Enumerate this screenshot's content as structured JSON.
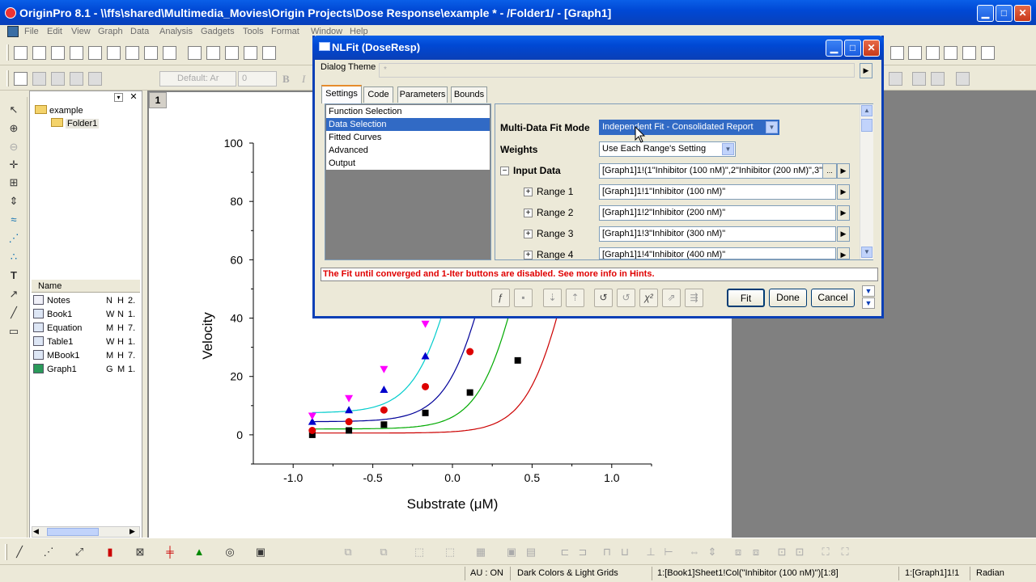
{
  "app": {
    "title": "OriginPro 8.1 - \\\\ffs\\shared\\Multimedia_Movies\\Origin Projects\\Dose Response\\example * - /Folder1/ - [Graph1]",
    "minimize": "▁",
    "maximize": "□",
    "close": "✕"
  },
  "menu": [
    "File",
    "Edit",
    "View",
    "Graph",
    "Data",
    "Analysis",
    "Gadgets",
    "Tools",
    "Format",
    "Window",
    "Help"
  ],
  "format_toolbar": {
    "font": "Default: Ar",
    "size": "0",
    "bold": "B",
    "italic": "I"
  },
  "explorer": {
    "root": "example",
    "folder": "Folder1",
    "list_header": "Name",
    "items": [
      {
        "name": "Notes",
        "c2": "N",
        "c3": "H",
        "c4": "2."
      },
      {
        "name": "Book1",
        "c2": "W",
        "c3": "N",
        "c4": "1."
      },
      {
        "name": "Equation",
        "c2": "M",
        "c3": "H",
        "c4": "7."
      },
      {
        "name": "Table1",
        "c2": "W",
        "c3": "H",
        "c4": "1."
      },
      {
        "name": "MBook1",
        "c2": "M",
        "c3": "H",
        "c4": "7."
      },
      {
        "name": "Graph1",
        "c2": "G",
        "c3": "M",
        "c4": "1."
      }
    ]
  },
  "page_number": "1",
  "chart_data": {
    "type": "scatter",
    "xlabel": "Substrate (μM)",
    "ylabel": "Velocity",
    "xlim": [
      -1.25,
      1.25
    ],
    "ylim": [
      -10,
      100
    ],
    "x_ticks": [
      "-1.0",
      "-0.5",
      "0.0",
      "0.5",
      "1.0"
    ],
    "y_ticks": [
      "0",
      "20",
      "40",
      "60",
      "80",
      "100"
    ],
    "series": [
      {
        "color": "#000000",
        "marker": "square",
        "x": [
          -0.88,
          -0.65,
          -0.43,
          -0.17,
          0.11,
          0.41
        ],
        "y": [
          0,
          1.5,
          3.5,
          7.5,
          14.5,
          25.5
        ]
      },
      {
        "color": "#dd0000",
        "marker": "circle",
        "x": [
          -0.88,
          -0.65,
          -0.43,
          -0.17,
          0.11
        ],
        "y": [
          1.5,
          4.5,
          8.5,
          16.5,
          28.5
        ]
      },
      {
        "color": "#0000cc",
        "marker": "triangle-up",
        "x": [
          -0.88,
          -0.65,
          -0.43,
          -0.17
        ],
        "y": [
          4.5,
          8.5,
          15.5,
          27
        ]
      },
      {
        "color": "#ff00ff",
        "marker": "triangle-down",
        "x": [
          -0.88,
          -0.65,
          -0.43,
          -0.17
        ],
        "y": [
          6.5,
          12.5,
          22.5,
          38
        ]
      }
    ]
  },
  "dialog": {
    "title": "NLFit (DoseResp)",
    "theme_label": "Dialog Theme",
    "theme_value": "*",
    "tabs": [
      "Settings",
      "Code",
      "Parameters",
      "Bounds"
    ],
    "nav_items": [
      "Function Selection",
      "Data Selection",
      "Fitted Curves",
      "Advanced",
      "Output"
    ],
    "multi_data_label": "Multi-Data Fit Mode",
    "multi_data_value": "Independent Fit - Consolidated Report",
    "weights_label": "Weights",
    "weights_value": "Use Each Range's Setting",
    "input_data_label": "Input Data",
    "input_data_value": "[Graph1]1!(1\"Inhibitor (100 nM)\",2\"Inhibitor (200 nM)\",3\"",
    "ellipsis": "...",
    "ranges": [
      {
        "label": "Range 1",
        "value": "[Graph1]1!1\"Inhibitor (100 nM)\""
      },
      {
        "label": "Range 2",
        "value": "[Graph1]1!2\"Inhibitor (200 nM)\""
      },
      {
        "label": "Range 3",
        "value": "[Graph1]1!3\"Inhibitor (300 nM)\""
      },
      {
        "label": "Range 4",
        "value": "[Graph1]1!4\"Inhibitor (400 nM)\""
      }
    ],
    "hint": "The Fit until converged and 1-Iter buttons are disabled. See more info in Hints.",
    "fit_button": "Fit",
    "done_button": "Done",
    "cancel_button": "Cancel"
  },
  "status": {
    "au": "AU : ON",
    "theme": "Dark Colors & Light Grids",
    "column": "1:[Book1]Sheet1!Col(\"Inhibitor (100 nM)\")[1:8]",
    "layer": "1:[Graph1]1!1",
    "angle": "Radian"
  }
}
